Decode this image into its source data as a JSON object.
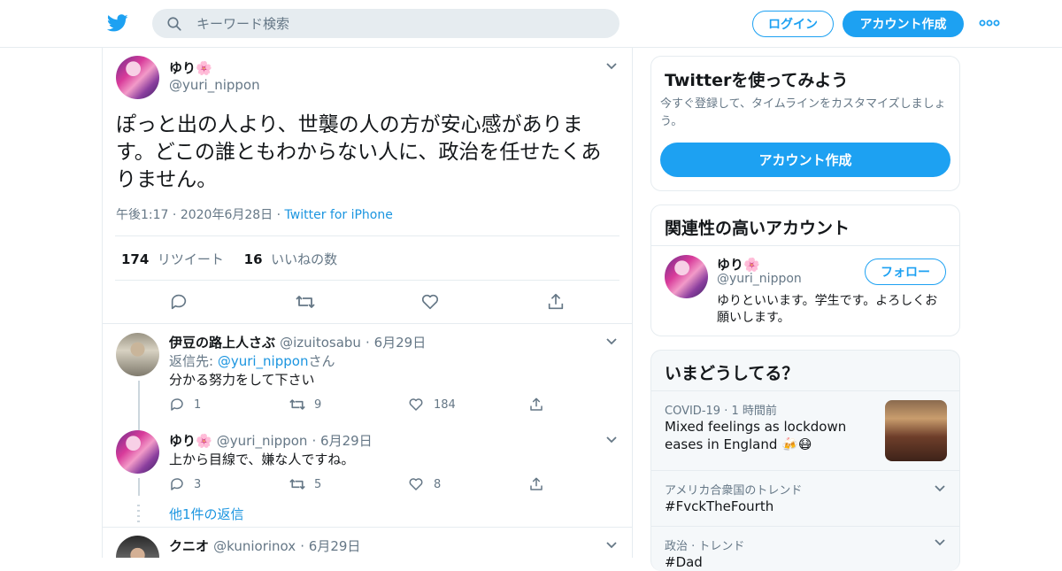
{
  "header": {
    "search_placeholder": "キーワード検索",
    "login_label": "ログイン",
    "signup_label": "アカウント作成"
  },
  "tweet": {
    "name": "ゆり🌸",
    "handle": "@yuri_nippon",
    "text": "ぽっと出の人より、世襲の人の方が安心感があります。どこの誰ともわからない人に、政治を任せたくありません。",
    "time": "午後1:17",
    "date": "2020年6月28日",
    "source": "Twitter for iPhone",
    "retweets_count": "174",
    "retweets_label": "リツイート",
    "likes_count": "16",
    "likes_label": "いいねの数"
  },
  "replies": [
    {
      "name": "伊豆の路上人さぶ",
      "handle": "@izuitosabu",
      "date": "6月29日",
      "reply_to_prefix": "返信先: ",
      "reply_to_handle": "@yuri_nippon",
      "reply_to_suffix": "さん",
      "text": "分かる努力をして下さい",
      "reply_count": "1",
      "retweet_count": "9",
      "like_count": "184"
    },
    {
      "name": "ゆり🌸",
      "handle": "@yuri_nippon",
      "date": "6月29日",
      "text": "上から目線で、嫌な人ですね。",
      "reply_count": "3",
      "retweet_count": "5",
      "like_count": "8"
    },
    {
      "name": "クニオ",
      "handle": "@kuniorinox",
      "date": "6月29日"
    }
  ],
  "more_replies": "他1件の返信",
  "sidebar": {
    "try_title": "Twitterを使ってみよう",
    "try_desc": "今すぐ登録して、タイムラインをカスタマイズしましょう。",
    "try_button": "アカウント作成",
    "related_title": "関連性の高いアカウント",
    "related_name": "ゆり🌸",
    "related_handle": "@yuri_nippon",
    "follow_label": "フォロー",
    "related_bio": "ゆりといいます。学生です。よろしくお願いします。",
    "trends_title": "いまどうしてる？",
    "trends": [
      {
        "meta_a": "COVID-19",
        "meta_b": "1 時間前",
        "title": "Mixed feelings as lockdown eases in England 🍻😷"
      },
      {
        "meta_a": "アメリカ合衆国のトレンド",
        "title": "#FvckTheFourth"
      },
      {
        "meta_a": "政治",
        "meta_b": "トレンド",
        "title": "#Dad"
      }
    ]
  },
  "colors": {
    "accent": "#1da1f2",
    "link": "#1b95e0",
    "muted": "#657786",
    "border": "#e6ecf0"
  }
}
